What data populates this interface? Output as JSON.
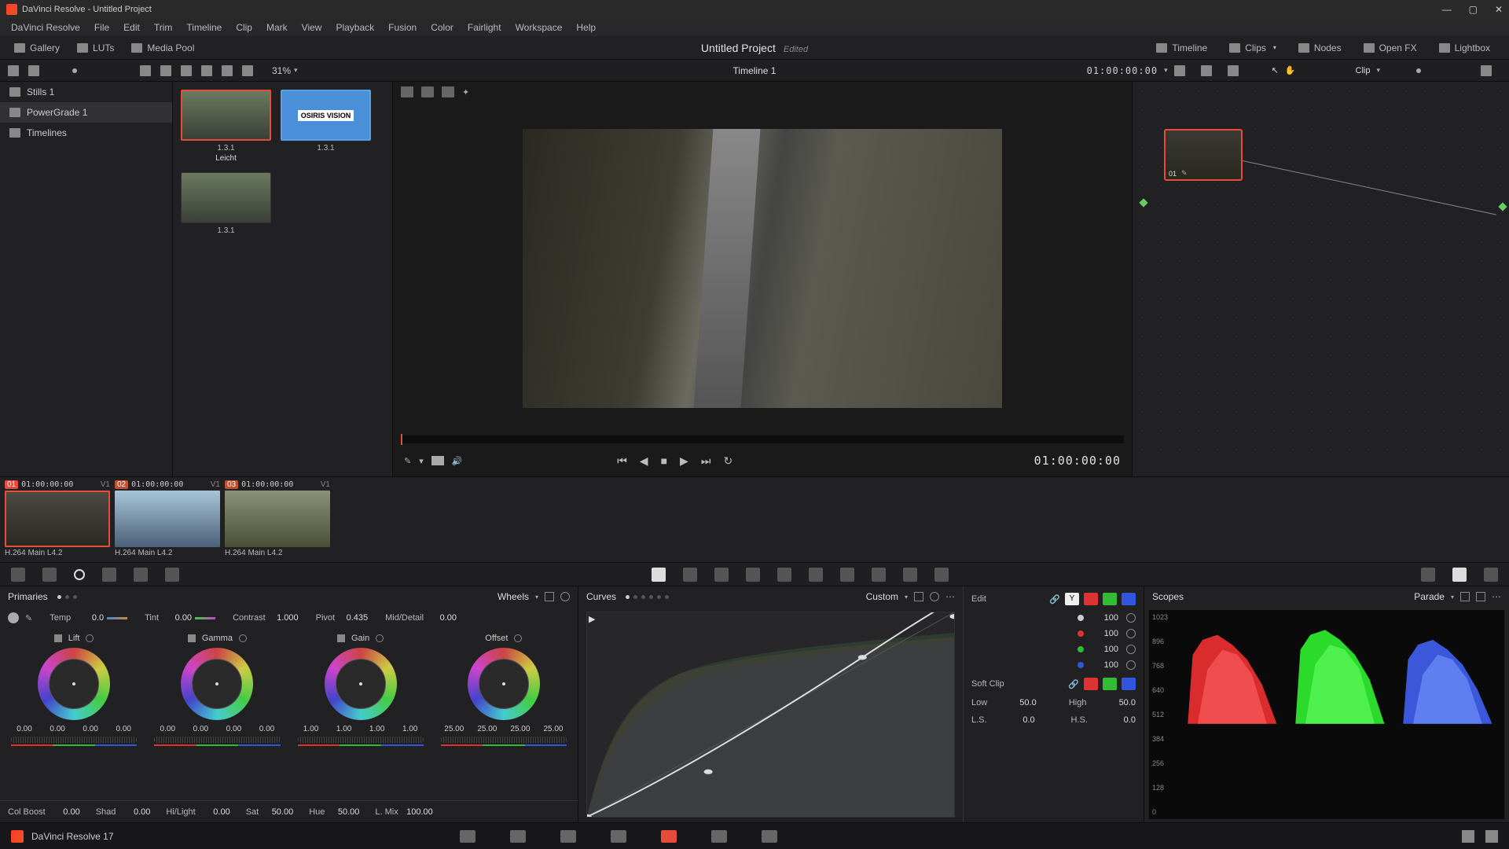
{
  "titlebar": {
    "text": "DaVinci Resolve - Untitled Project"
  },
  "menubar": [
    "DaVinci Resolve",
    "File",
    "Edit",
    "Trim",
    "Timeline",
    "Clip",
    "Mark",
    "View",
    "Playback",
    "Fusion",
    "Color",
    "Fairlight",
    "Workspace",
    "Help"
  ],
  "toptoolbar": {
    "left": [
      {
        "id": "gallery",
        "label": "Gallery"
      },
      {
        "id": "luts",
        "label": "LUTs"
      },
      {
        "id": "mediapool",
        "label": "Media Pool"
      }
    ],
    "project": "Untitled Project",
    "edited": "Edited",
    "right": [
      {
        "id": "timeline",
        "label": "Timeline"
      },
      {
        "id": "clips",
        "label": "Clips"
      },
      {
        "id": "nodes",
        "label": "Nodes"
      },
      {
        "id": "openfx",
        "label": "Open FX"
      },
      {
        "id": "lightbox",
        "label": "Lightbox"
      }
    ]
  },
  "secbar": {
    "zoom": "31%",
    "timeline_name": "Timeline 1",
    "timecode": "01:00:00:00",
    "clip_label": "Clip"
  },
  "gallery": {
    "albums": [
      {
        "label": "Stills 1",
        "selected": false
      },
      {
        "label": "PowerGrade 1",
        "selected": true
      },
      {
        "label": "Timelines",
        "selected": false
      }
    ],
    "thumbs": [
      {
        "cap": "1.3.1",
        "cap2": "Leicht",
        "selected": true,
        "blue": false
      },
      {
        "cap": "1.3.1",
        "cap2": "",
        "selected": false,
        "blue": true,
        "blue_label": "OSIRIS VISION"
      },
      {
        "cap": "1.3.1",
        "cap2": "",
        "selected": false,
        "blue": false
      }
    ]
  },
  "viewer": {
    "tc": "01:00:00:00"
  },
  "nodes": {
    "node_label": "01"
  },
  "clips": [
    {
      "num": "01",
      "tc": "01:00:00:00",
      "v": "V1",
      "cap": "H.264 Main L4.2",
      "selected": true
    },
    {
      "num": "02",
      "tc": "01:00:00:00",
      "v": "V1",
      "cap": "H.264 Main L4.2",
      "selected": false
    },
    {
      "num": "03",
      "tc": "01:00:00:00",
      "v": "V1",
      "cap": "H.264 Main L4.2",
      "selected": false
    }
  ],
  "primaries": {
    "title": "Primaries",
    "mode": "Wheels",
    "row1": {
      "temp_label": "Temp",
      "temp": "0.0",
      "tint_label": "Tint",
      "tint": "0.00",
      "contrast_label": "Contrast",
      "contrast": "1.000",
      "pivot_label": "Pivot",
      "pivot": "0.435",
      "mid_label": "Mid/Detail",
      "mid": "0.00"
    },
    "wheels": [
      {
        "name": "Lift",
        "vals": [
          "0.00",
          "0.00",
          "0.00",
          "0.00"
        ]
      },
      {
        "name": "Gamma",
        "vals": [
          "0.00",
          "0.00",
          "0.00",
          "0.00"
        ]
      },
      {
        "name": "Gain",
        "vals": [
          "1.00",
          "1.00",
          "1.00",
          "1.00"
        ]
      },
      {
        "name": "Offset",
        "vals": [
          "25.00",
          "25.00",
          "25.00",
          "25.00"
        ]
      }
    ],
    "row2": {
      "colboost_label": "Col Boost",
      "colboost": "0.00",
      "shad_label": "Shad",
      "shad": "0.00",
      "hl_label": "Hi/Light",
      "hl": "0.00",
      "sat_label": "Sat",
      "sat": "50.00",
      "hue_label": "Hue",
      "hue": "50.00",
      "lmix_label": "L. Mix",
      "lmix": "100.00"
    }
  },
  "curves": {
    "title": "Curves",
    "mode": "Custom",
    "edit_label": "Edit",
    "channels": [
      {
        "color": "#ccc",
        "val": "100"
      },
      {
        "color": "#d33",
        "val": "100"
      },
      {
        "color": "#3b3",
        "val": "100"
      },
      {
        "color": "#35d",
        "val": "100"
      }
    ],
    "softclip_label": "Soft Clip",
    "low_label": "Low",
    "low": "50.0",
    "high_label": "High",
    "high": "50.0",
    "ls_label": "L.S.",
    "ls": "0.0",
    "hs_label": "H.S.",
    "hs": "0.0"
  },
  "scopes": {
    "title": "Scopes",
    "mode": "Parade",
    "ticks": [
      "1023",
      "896",
      "768",
      "640",
      "512",
      "384",
      "256",
      "128",
      "0"
    ]
  },
  "pagenav": {
    "app": "DaVinci Resolve 17",
    "pages": [
      "media",
      "cut",
      "edit",
      "fusion",
      "color",
      "fairlight",
      "deliver"
    ],
    "active": "color"
  }
}
